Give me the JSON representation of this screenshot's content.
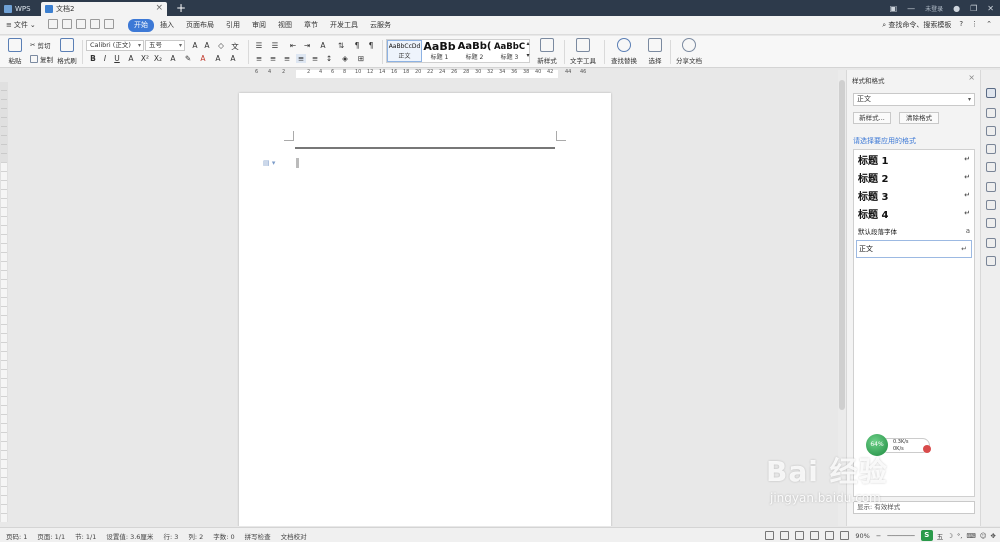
{
  "titlebar": {
    "wps_tab": "WPS",
    "doc_tab": "文档2",
    "new_tab": "+",
    "login": "未登录"
  },
  "menubar": {
    "file_menu": "文件",
    "menus": [
      "开始",
      "插入",
      "页面布局",
      "引用",
      "审阅",
      "视图",
      "章节",
      "开发工具",
      "云服务"
    ],
    "active_menu": "开始",
    "search": "查找命令、搜索模板",
    "help": "?"
  },
  "ribbon": {
    "paste": "粘贴",
    "cut": "剪切",
    "copy": "复制",
    "format_painter": "格式刷",
    "font_name": "Calibri (正文)",
    "font_size": "五号",
    "styles": [
      {
        "sample": "AaBbCcDd",
        "label": "正文"
      },
      {
        "sample": "AaBb",
        "label": "标题 1"
      },
      {
        "sample": "AaBb(",
        "label": "标题 2"
      },
      {
        "sample": "AaBbC",
        "label": "标题 3"
      }
    ],
    "new_style": "新样式",
    "text_tools": "文字工具",
    "find_replace": "查找替换",
    "select": "选择",
    "share_doc": "分享文档"
  },
  "ruler": {
    "numbers": [
      "6",
      "4",
      "2",
      "2",
      "4",
      "6",
      "8",
      "10",
      "12",
      "14",
      "16",
      "18",
      "20",
      "22",
      "24",
      "26",
      "28",
      "30",
      "32",
      "34",
      "36",
      "38",
      "40",
      "42",
      "44",
      "46"
    ]
  },
  "sidepanel": {
    "title": "样式和格式",
    "current_style": "正文",
    "new_style_button": "新样式...",
    "clear_format_button": "清除格式",
    "list_label": "请选择要应用的格式",
    "items": [
      {
        "label": "标题  1",
        "kind": "h"
      },
      {
        "label": "标题  2",
        "kind": "h"
      },
      {
        "label": "标题  3",
        "kind": "h"
      },
      {
        "label": "标题  4",
        "kind": "h"
      },
      {
        "label": "默认段落字体",
        "kind": "small"
      },
      {
        "label": "正文",
        "kind": "sel"
      }
    ],
    "footer": "显示: 有效样式"
  },
  "netwidget": {
    "percent": "64%",
    "up": "0.3K/s",
    "down": "0K/s"
  },
  "statusbar": {
    "items": [
      "页码: 1",
      "页面: 1/1",
      "节: 1/1",
      "设置值: 3.6厘米",
      "行: 3",
      "列: 2",
      "字数: 0",
      "拼写检查",
      "文档校对"
    ],
    "zoom": "90%",
    "ime": "五"
  },
  "watermark": {
    "main": "Bai 经验",
    "sub": "jingyan.baidu.com"
  }
}
